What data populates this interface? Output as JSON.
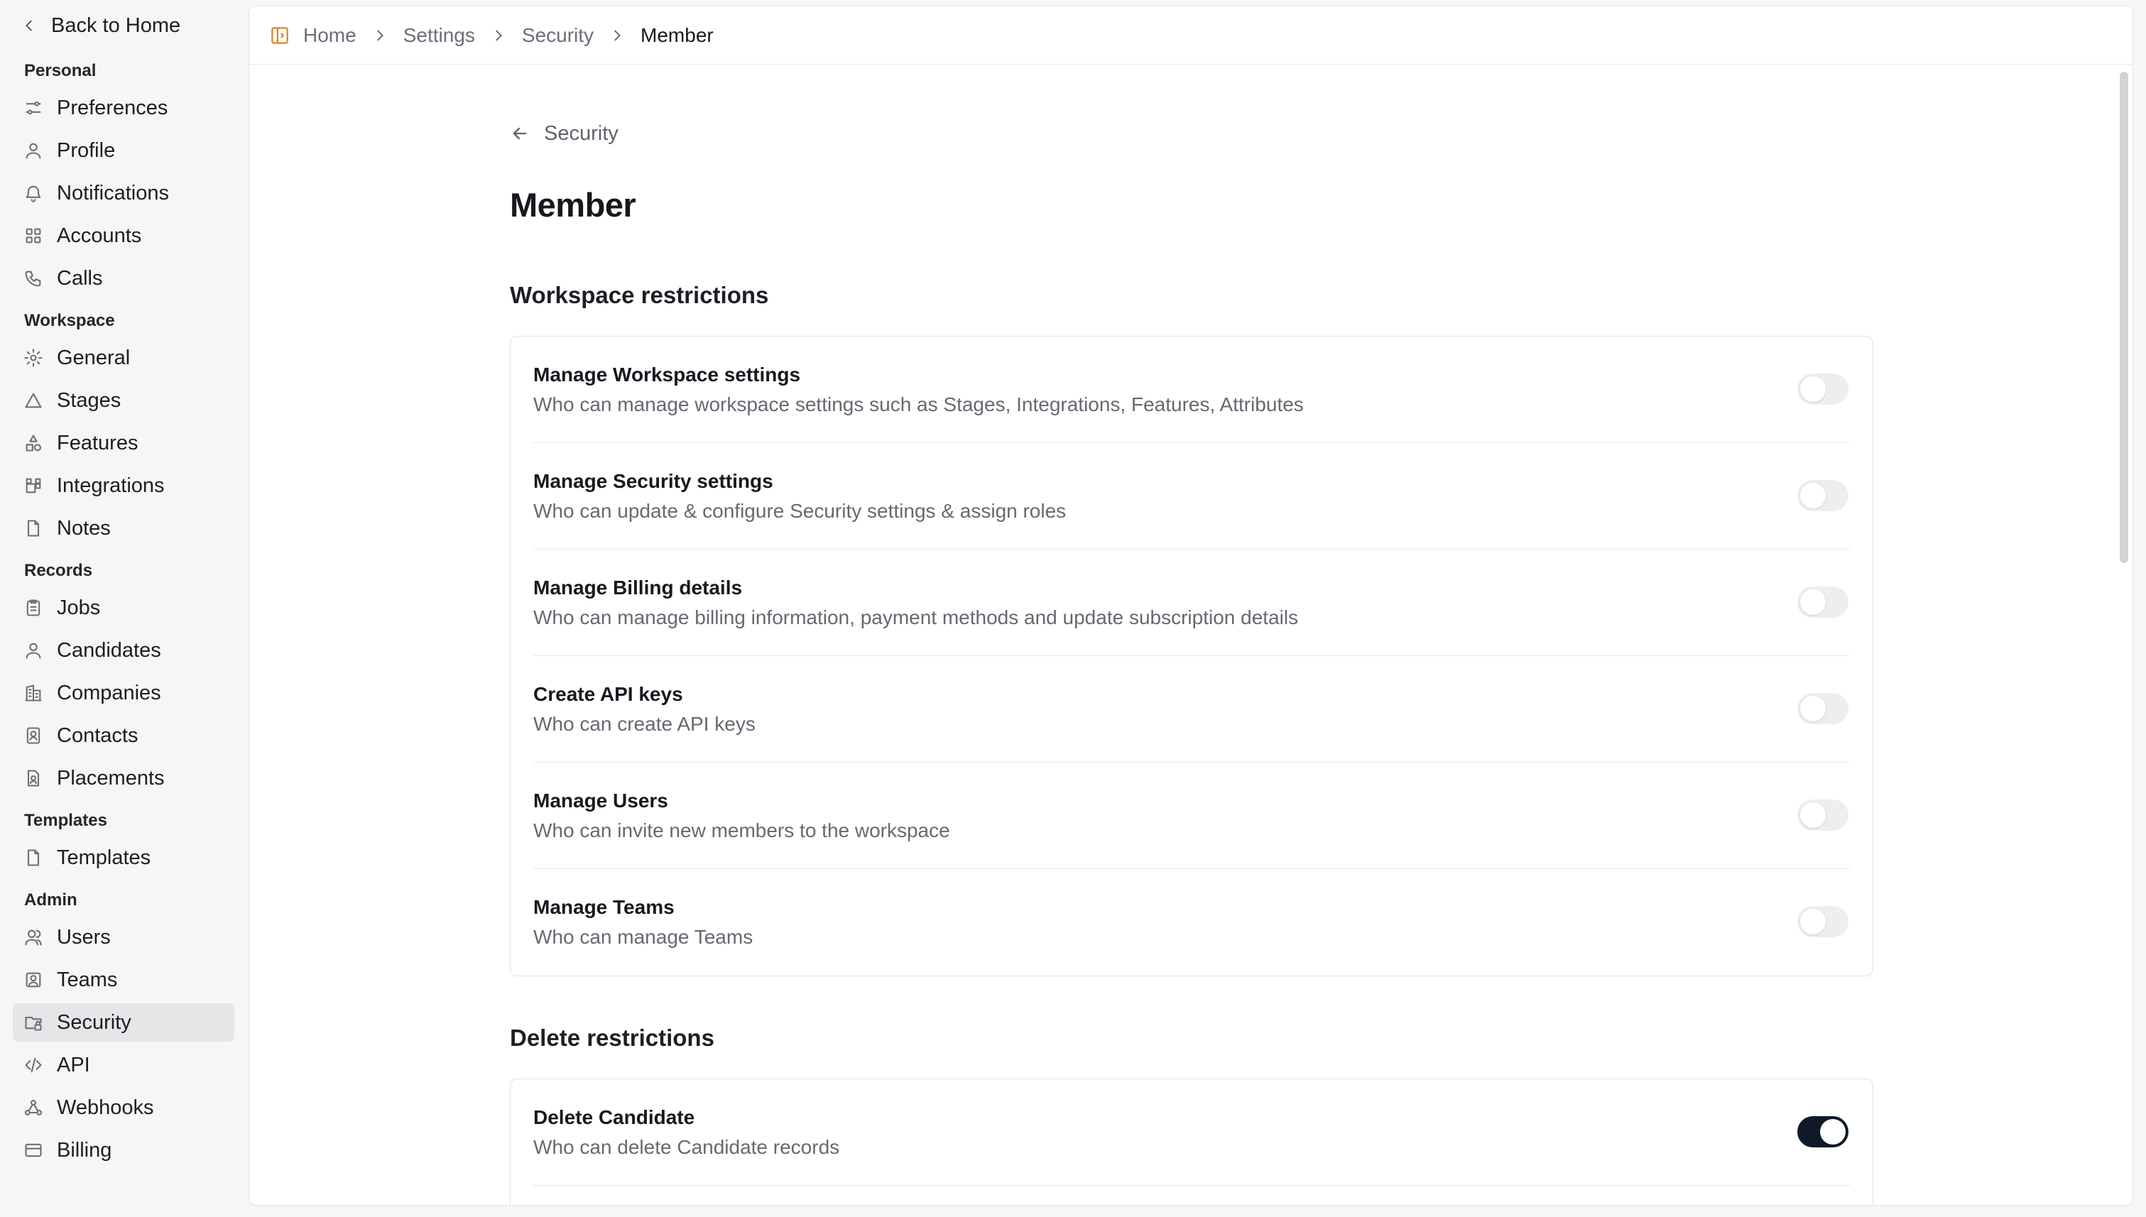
{
  "sidebar": {
    "back_label": "Back to Home",
    "sections": [
      {
        "title": "Personal",
        "items": [
          {
            "label": "Preferences",
            "icon": "sliders-icon"
          },
          {
            "label": "Profile",
            "icon": "user-icon"
          },
          {
            "label": "Notifications",
            "icon": "bell-icon"
          },
          {
            "label": "Accounts",
            "icon": "grid-icon"
          },
          {
            "label": "Calls",
            "icon": "phone-icon"
          }
        ]
      },
      {
        "title": "Workspace",
        "items": [
          {
            "label": "General",
            "icon": "gear-icon"
          },
          {
            "label": "Stages",
            "icon": "triangle-icon"
          },
          {
            "label": "Features",
            "icon": "shapes-icon"
          },
          {
            "label": "Integrations",
            "icon": "puzzle-icon"
          },
          {
            "label": "Notes",
            "icon": "file-icon"
          }
        ]
      },
      {
        "title": "Records",
        "items": [
          {
            "label": "Jobs",
            "icon": "clipboard-icon"
          },
          {
            "label": "Candidates",
            "icon": "user-icon"
          },
          {
            "label": "Companies",
            "icon": "building-icon"
          },
          {
            "label": "Contacts",
            "icon": "contact-card-icon"
          },
          {
            "label": "Placements",
            "icon": "placement-icon"
          }
        ]
      },
      {
        "title": "Templates",
        "items": [
          {
            "label": "Templates",
            "icon": "file-icon"
          }
        ]
      },
      {
        "title": "Admin",
        "items": [
          {
            "label": "Users",
            "icon": "users-icon"
          },
          {
            "label": "Teams",
            "icon": "team-icon"
          },
          {
            "label": "Security",
            "icon": "folder-lock-icon",
            "active": true
          },
          {
            "label": "API",
            "icon": "code-icon"
          },
          {
            "label": "Webhooks",
            "icon": "webhook-icon"
          },
          {
            "label": "Billing",
            "icon": "credit-card-icon"
          }
        ]
      }
    ]
  },
  "breadcrumb": [
    "Home",
    "Settings",
    "Security",
    "Member"
  ],
  "page": {
    "back_label": "Security",
    "title": "Member"
  },
  "workspace_restrictions": {
    "title": "Workspace restrictions",
    "rows": [
      {
        "title": "Manage Workspace settings",
        "desc": "Who can manage workspace settings such as Stages, Integrations, Features, Attributes",
        "enabled": false
      },
      {
        "title": "Manage Security settings",
        "desc": "Who can update & configure Security settings & assign roles",
        "enabled": false
      },
      {
        "title": "Manage Billing details",
        "desc": "Who can manage billing information, payment methods and update subscription details",
        "enabled": false
      },
      {
        "title": "Create API keys",
        "desc": "Who can create API keys",
        "enabled": false
      },
      {
        "title": "Manage Users",
        "desc": "Who can invite new members to the workspace",
        "enabled": false
      },
      {
        "title": "Manage Teams",
        "desc": "Who can manage Teams",
        "enabled": false
      }
    ]
  },
  "delete_restrictions": {
    "title": "Delete restrictions",
    "rows": [
      {
        "title": "Delete Candidate",
        "desc": "Who can delete Candidate records",
        "enabled": true
      }
    ]
  },
  "colors": {
    "toggle_on": "#0f1a29",
    "toggle_off": "#eeeeef",
    "active_nav_bg": "#e6e6e8",
    "home_icon": "#d9822b"
  }
}
